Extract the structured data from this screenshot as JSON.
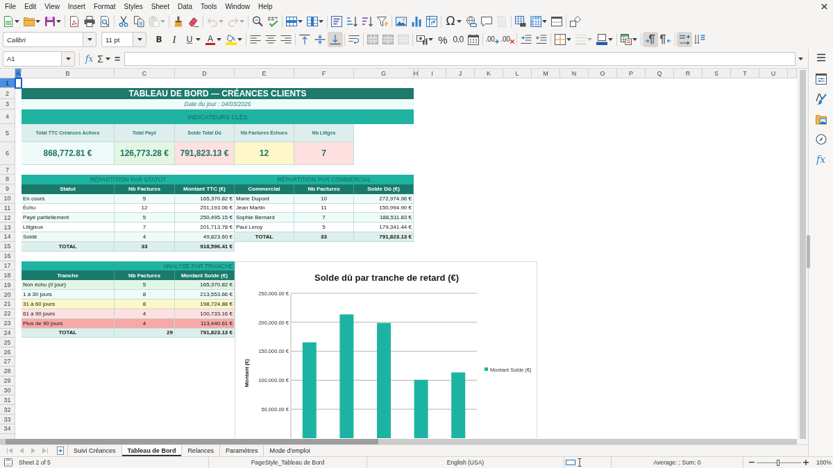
{
  "menu_bar": {
    "items": [
      "File",
      "Edit",
      "View",
      "Insert",
      "Format",
      "Styles",
      "Sheet",
      "Data",
      "Tools",
      "Window",
      "Help"
    ]
  },
  "standard_toolbar": {
    "groups": [
      [
        {
          "dropdown": true,
          "disabled": false
        },
        {
          "dropdown": true,
          "disabled": false
        },
        {
          "dropdown": true,
          "disabled": false
        }
      ],
      [
        {
          "dropdown": false,
          "disabled": false
        },
        {
          "dropdown": false,
          "disabled": false
        },
        {
          "dropdown": false,
          "disabled": false
        }
      ],
      [
        {
          "dropdown": false,
          "disabled": false
        },
        {
          "dropdown": false,
          "disabled": false
        },
        {
          "dropdown": true,
          "disabled": true
        }
      ],
      [
        {
          "dropdown": false,
          "disabled": false
        },
        {
          "dropdown": false,
          "disabled": false
        }
      ],
      [
        {
          "dropdown": true,
          "disabled": true
        },
        {
          "dropdown": true,
          "disabled": true
        }
      ],
      [
        {
          "dropdown": false,
          "disabled": false
        },
        {
          "dropdown": false,
          "disabled": false
        }
      ],
      [
        {
          "dropdown": true,
          "disabled": false
        },
        {
          "dropdown": true,
          "disabled": false
        }
      ],
      [
        {
          "dropdown": false,
          "disabled": false
        },
        {
          "dropdown": false,
          "disabled": false
        },
        {
          "dropdown": false,
          "disabled": false
        },
        {
          "dropdown": false,
          "disabled": false
        }
      ],
      [
        {
          "dropdown": false,
          "disabled": false
        },
        {
          "dropdown": false,
          "disabled": false
        },
        {
          "dropdown": false,
          "disabled": false
        }
      ],
      [
        {
          "label": "Ω",
          "dropdown": true,
          "disabled": false
        },
        {
          "dropdown": false,
          "disabled": false
        },
        {
          "dropdown": false,
          "disabled": false
        },
        {
          "dropdown": false,
          "disabled": true
        }
      ],
      [
        {
          "dropdown": false,
          "disabled": false
        },
        {
          "dropdown": true,
          "disabled": false
        },
        {
          "dropdown": false,
          "disabled": false
        }
      ],
      [
        {
          "dropdown": false,
          "disabled": false
        }
      ]
    ]
  },
  "formatting_toolbar": {
    "font_name": "Calibri",
    "font_size": "11 pt",
    "groups": [
      [
        {
          "label": "B",
          "dropdown": false,
          "disabled": false,
          "pressed": false
        },
        {
          "label": "I",
          "dropdown": false,
          "disabled": false,
          "pressed": false
        },
        {
          "label": "U",
          "dropdown": true,
          "disabled": false,
          "pressed": false
        },
        {
          "label": "A",
          "dropdown": true,
          "disabled": false,
          "pressed": false
        },
        {
          "dropdown": true,
          "disabled": false,
          "pressed": false
        }
      ],
      [
        {
          "dropdown": false,
          "disabled": false,
          "pressed": false
        },
        {
          "dropdown": false,
          "disabled": false,
          "pressed": false
        },
        {
          "dropdown": false,
          "disabled": false,
          "pressed": false
        }
      ],
      [
        {
          "dropdown": false,
          "disabled": false,
          "pressed": false
        },
        {
          "dropdown": false,
          "disabled": false,
          "pressed": false
        },
        {
          "dropdown": false,
          "disabled": false,
          "pressed": true
        }
      ],
      [
        {
          "dropdown": false,
          "disabled": false,
          "pressed": false
        }
      ],
      [
        {
          "dropdown": false,
          "disabled": false,
          "pressed": false
        },
        {
          "dropdown": false,
          "disabled": false,
          "pressed": false
        },
        {
          "dropdown": false,
          "disabled": true,
          "pressed": false
        }
      ],
      [
        {
          "dropdown": true,
          "disabled": false,
          "pressed": false
        },
        {
          "label": "%",
          "dropdown": false,
          "disabled": false,
          "pressed": false
        },
        {
          "label": "0.0",
          "dropdown": false,
          "disabled": false,
          "pressed": false
        },
        {
          "dropdown": false,
          "disabled": false,
          "pressed": false
        }
      ],
      [
        {
          "label": ".00",
          "dropdown": false,
          "disabled": false,
          "pressed": false
        },
        {
          "label": ".00",
          "dropdown": false,
          "disabled": false,
          "pressed": false
        }
      ],
      [
        {
          "dropdown": false,
          "disabled": false,
          "pressed": false
        },
        {
          "dropdown": false,
          "disabled": false,
          "pressed": false
        }
      ],
      [
        {
          "dropdown": true,
          "disabled": false,
          "pressed": false
        },
        {
          "dropdown": true,
          "disabled": true,
          "pressed": false
        },
        {
          "dropdown": true,
          "disabled": false,
          "pressed": false
        }
      ],
      [
        {
          "dropdown": true,
          "disabled": false,
          "pressed": false
        }
      ],
      [
        {
          "dropdown": false,
          "disabled": false,
          "pressed": true
        },
        {
          "dropdown": false,
          "disabled": false,
          "pressed": false
        }
      ],
      [
        {
          "dropdown": false,
          "disabled": false,
          "pressed": true
        },
        {
          "dropdown": false,
          "disabled": false,
          "pressed": false
        }
      ]
    ]
  },
  "formula_bar": {
    "name_box": "A1",
    "function_wizard": "fx",
    "sum": "Σ",
    "equals": "="
  },
  "sheet": {
    "columns": [
      {
        "label": "A",
        "selected": true
      },
      {
        "label": "B",
        "selected": false
      },
      {
        "label": "C",
        "selected": false
      },
      {
        "label": "D",
        "selected": false
      },
      {
        "label": "E",
        "selected": false
      },
      {
        "label": "F",
        "selected": false
      },
      {
        "label": "G",
        "selected": false
      },
      {
        "label": "H",
        "selected": false
      },
      {
        "label": "I",
        "selected": false
      },
      {
        "label": "J",
        "selected": false
      },
      {
        "label": "K",
        "selected": false
      },
      {
        "label": "L",
        "selected": false
      },
      {
        "label": "M",
        "selected": false
      },
      {
        "label": "N",
        "selected": false
      },
      {
        "label": "O",
        "selected": false
      },
      {
        "label": "P",
        "selected": false
      },
      {
        "label": "Q",
        "selected": false
      },
      {
        "label": "R",
        "selected": false
      },
      {
        "label": "S",
        "selected": false
      },
      {
        "label": "T",
        "selected": false
      },
      {
        "label": "U",
        "selected": false
      }
    ],
    "rows": [
      {
        "label": "1",
        "selected": true
      },
      {
        "label": "2",
        "selected": false
      },
      {
        "label": "3",
        "selected": false
      },
      {
        "label": "4",
        "selected": false
      },
      {
        "label": "5",
        "selected": false
      },
      {
        "label": "6",
        "selected": false
      },
      {
        "label": "7",
        "selected": false
      },
      {
        "label": "8",
        "selected": false
      },
      {
        "label": "9",
        "selected": false
      },
      {
        "label": "10",
        "selected": false
      },
      {
        "label": "11",
        "selected": false
      },
      {
        "label": "12",
        "selected": false
      },
      {
        "label": "13",
        "selected": false
      },
      {
        "label": "14",
        "selected": false
      },
      {
        "label": "15",
        "selected": false
      },
      {
        "label": "16",
        "selected": false
      },
      {
        "label": "17",
        "selected": false
      },
      {
        "label": "18",
        "selected": false
      },
      {
        "label": "19",
        "selected": false
      },
      {
        "label": "20",
        "selected": false
      },
      {
        "label": "21",
        "selected": false
      },
      {
        "label": "22",
        "selected": false
      },
      {
        "label": "23",
        "selected": false
      },
      {
        "label": "24",
        "selected": false
      },
      {
        "label": "25",
        "selected": false
      },
      {
        "label": "26",
        "selected": false
      },
      {
        "label": "27",
        "selected": false
      },
      {
        "label": "28",
        "selected": false
      },
      {
        "label": "29",
        "selected": false
      },
      {
        "label": "30",
        "selected": false
      },
      {
        "label": "31",
        "selected": false
      },
      {
        "label": "32",
        "selected": false
      },
      {
        "label": "33",
        "selected": false
      },
      {
        "label": "34",
        "selected": false
      }
    ],
    "title": "TABLEAU DE BORD — CRÉANCES CLIENTS",
    "date": "Date du jour : 04/03/2026",
    "kpi_section": "INDICATEURS CLÉS",
    "kpis": [
      {
        "label": "Total TTC Créances Actives",
        "value": "868,772.81 €",
        "color": "#effbf9"
      },
      {
        "label": "Total Payé",
        "value": "126,773.28 €",
        "color": "#e3f6e1"
      },
      {
        "label": "Solde Total Dû",
        "value": "791,823.13 €",
        "color": "#fde0df"
      },
      {
        "label": "Nb Factures Échues",
        "value": "12",
        "color": "#fef7c9"
      },
      {
        "label": "Nb Litiges",
        "value": "7",
        "color": "#fde0df"
      }
    ],
    "tables": [
      {
        "title": "RÉPARTITION PAR STATUT",
        "columns": [
          "Statut",
          "Nb Factures",
          "Montant TTC (€)"
        ],
        "rows": [
          {
            "cells": [
              "En cours",
              "5",
              "165,370.82 €"
            ]
          },
          {
            "cells": [
              "Échu",
              "12",
              "251,193.06 €"
            ]
          },
          {
            "cells": [
              "Payé partiellement",
              "5",
              "250,495.15 €"
            ]
          },
          {
            "cells": [
              "Litigieux",
              "7",
              "201,713.78 €"
            ]
          },
          {
            "cells": [
              "Soldé",
              "4",
              "49,823.60 €"
            ]
          }
        ],
        "total": [
          "TOTAL",
          "33",
          "918,596.41 €"
        ]
      },
      {
        "title": "RÉPARTITION PAR COMMERCIAL",
        "columns": [
          "Commercial",
          "Nb Factures",
          "Solde Dû (€)"
        ],
        "rows": [
          {
            "cells": [
              "Marie Dupont",
              "10",
              "272,974.96 €"
            ]
          },
          {
            "cells": [
              "Jean Martin",
              "11",
              "150,994.90 €"
            ]
          },
          {
            "cells": [
              "Sophie Bernard",
              "7",
              "188,511.83 €"
            ]
          },
          {
            "cells": [
              "Paul Leroy",
              "5",
              "179,341.44 €"
            ]
          }
        ],
        "total": [
          "TOTAL",
          "33",
          "791,823.13 €"
        ]
      },
      {
        "title": "ANALYSE PAR TRANCHE",
        "columns": [
          "Tranche",
          "Nb Factures",
          "Montant Solde (€)"
        ],
        "rows": [
          {
            "cells": [
              "Non échu (0 jour)",
              "5",
              "165,370.82 €"
            ],
            "color": "#e2f6e7"
          },
          {
            "cells": [
              "1 à 30 jours",
              "8",
              "213,553.66 €"
            ],
            "color": "#eefbf9"
          },
          {
            "cells": [
              "31 à 60 jours",
              "8",
              "198,724.88 €"
            ],
            "color": "#fdf6c6"
          },
          {
            "cells": [
              "61 à 90 jours",
              "4",
              "100,733.16 €"
            ],
            "color": "#fde1e1"
          },
          {
            "cells": [
              "Plus de 90 jours",
              "4",
              "113,440.61 €"
            ],
            "color": "#f8a8a6"
          }
        ],
        "total": [
          "TOTAL",
          "29",
          "791,823.13 €"
        ]
      }
    ],
    "chart": {
      "chart_data": {
        "type": "bar",
        "title": "Solde dû par tranche de retard (€)",
        "ylabel": "Montant (€)",
        "series": [
          {
            "name": "Montant Solde (€)",
            "color": "#1db3a2",
            "values": [
              165370.82,
              213553.66,
              198724.88,
              100733.16,
              113440.61
            ]
          }
        ],
        "ylim": [
          0,
          250000
        ],
        "yticks": [
          {
            "value": 50000,
            "label": "50,000.00 €"
          },
          {
            "value": 100000,
            "label": "100,000.00 €"
          },
          {
            "value": 150000,
            "label": "150,000.00 €"
          },
          {
            "value": 200000,
            "label": "200,000.00 €"
          },
          {
            "value": 250000,
            "label": "250,000.00 €"
          }
        ],
        "grid": true
      }
    }
  },
  "sheet_tabs": {
    "navigation": [
      {
        "disabled": true
      },
      {
        "disabled": true
      },
      {
        "disabled": true
      },
      {
        "disabled": true
      }
    ],
    "tabs": [
      {
        "label": "Suivi Créances",
        "selected": false
      },
      {
        "label": "Tableau de Bord",
        "selected": true
      },
      {
        "label": "Relances",
        "selected": false
      },
      {
        "label": "Paramètres",
        "selected": false
      },
      {
        "label": "Mode d'emploi",
        "selected": false
      }
    ]
  },
  "sidebar": {
    "functions": "fx"
  },
  "status_bar": {
    "sheet": "Sheet 2 of 5",
    "page_style": "PageStyle_Tableau de Bord",
    "language": "English (USA)",
    "summary": "Average: ; Sum: 0",
    "zoom": {
      "level": 0.48,
      "value": "100%"
    }
  }
}
